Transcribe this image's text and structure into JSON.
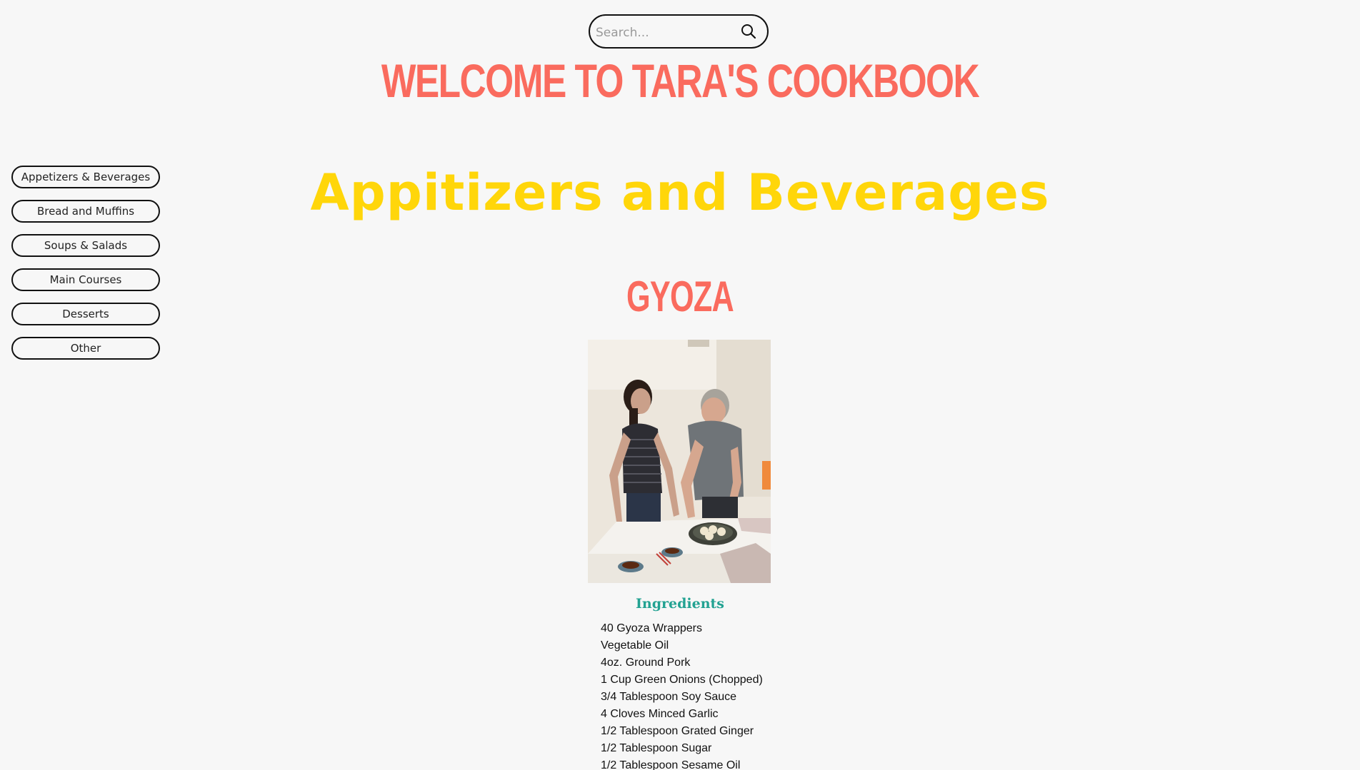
{
  "search": {
    "placeholder": "Search...",
    "icon": "search-icon"
  },
  "header": {
    "title": "WELCOME TO TARA'S COOKBOOK"
  },
  "sidebar": {
    "items": [
      {
        "label": "Appetizers & Beverages"
      },
      {
        "label": "Bread and Muffins"
      },
      {
        "label": "Soups & Salads"
      },
      {
        "label": "Main Courses"
      },
      {
        "label": "Desserts"
      },
      {
        "label": "Other"
      }
    ]
  },
  "main": {
    "category_title": "Appitizers and Beverages",
    "recipe": {
      "title": "GYOZA",
      "ingredients_heading": "Ingredients",
      "ingredients": [
        "40 Gyoza Wrappers",
        "Vegetable Oil",
        "4oz. Ground Pork",
        "1 Cup Green Onions (Chopped)",
        "3/4 Tablespoon Soy Sauce",
        "4 Cloves Minced Garlic",
        "1/2 Tablespoon Grated Ginger",
        "1/2 Tablespoon Sugar",
        "1/2 Tablespoon Sesame Oil"
      ]
    }
  },
  "colors": {
    "accent_coral": "#fa6b5e",
    "accent_yellow": "#ffd60a",
    "accent_teal": "#22a292",
    "background": "#f7f7f7"
  }
}
